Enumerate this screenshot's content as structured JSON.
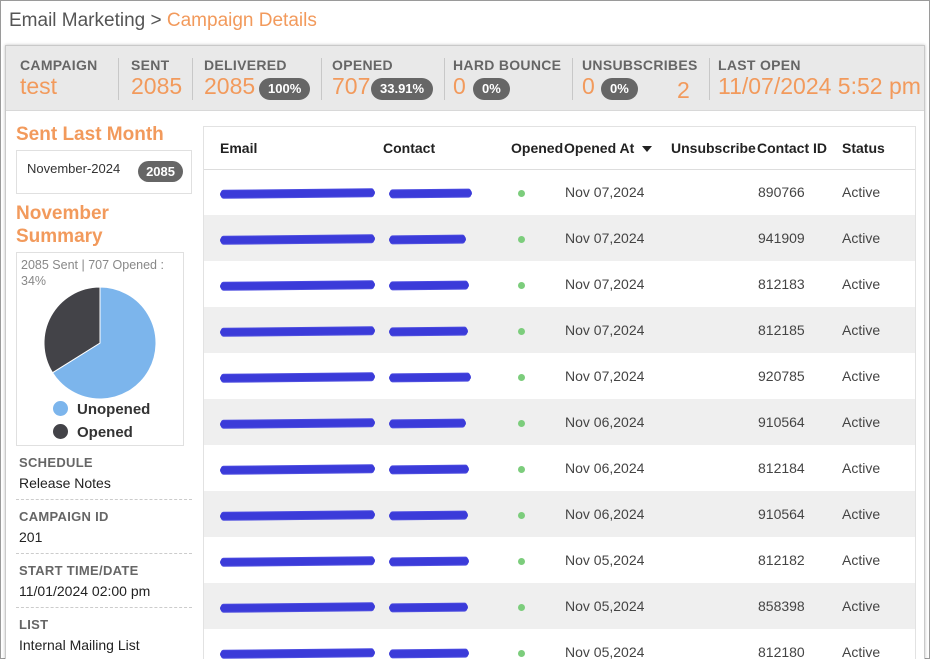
{
  "breadcrumb": {
    "parent": "Email Marketing",
    "separator": ">",
    "current": "Campaign Details"
  },
  "stats": {
    "campaign": {
      "label": "CAMPAIGN",
      "value": "test"
    },
    "sent": {
      "label": "SENT",
      "value": "2085"
    },
    "delivered": {
      "label": "DELIVERED",
      "value": "2085",
      "pct": "100%"
    },
    "opened": {
      "label": "OPENED",
      "value": "707",
      "pct": "33.91%"
    },
    "hard_bounce": {
      "label": "HARD BOUNCE",
      "value": "0",
      "pct": "0%"
    },
    "unsubscribes": {
      "label": "UNSUBSCRIBES",
      "value": "0",
      "pct": "0%",
      "extra": "2"
    },
    "last_open": {
      "label": "LAST OPEN",
      "value": "11/07/2024 5:52 pm"
    }
  },
  "sidebar": {
    "sent_last_month_title": "Sent Last Month",
    "month": "November-2024",
    "month_count": "2085",
    "summary_title": "November Summary",
    "pie_caption": "2085 Sent | 707 Opened : 34%",
    "legend": {
      "unopened": "Unopened",
      "opened": "Opened"
    },
    "meta": [
      {
        "label": "SCHEDULE",
        "value": "Release Notes"
      },
      {
        "label": "CAMPAIGN ID",
        "value": "201"
      },
      {
        "label": "START TIME/DATE",
        "value": "11/01/2024 02:00 pm"
      },
      {
        "label": "LIST",
        "value": "Internal Mailing List"
      }
    ]
  },
  "chart_data": {
    "type": "pie",
    "labels": [
      "Unopened",
      "Opened"
    ],
    "values": [
      1378,
      707
    ],
    "colors": [
      "#7cb5ec",
      "#434348"
    ]
  },
  "colors": {
    "accent": "#f29a5c",
    "pill": "#666666",
    "opened_dot": "#7ccd7c"
  },
  "table": {
    "headers": [
      "Email",
      "Contact",
      "Opened",
      "Opened At",
      "Unsubscribe",
      "Contact ID",
      "Status"
    ],
    "sort_icon": "sort-down-icon",
    "rows": [
      {
        "opened_at": "Nov 07,2024",
        "contact_id": "890766",
        "status": "Active"
      },
      {
        "opened_at": "Nov 07,2024",
        "contact_id": "941909",
        "status": "Active"
      },
      {
        "opened_at": "Nov 07,2024",
        "contact_id": "812183",
        "status": "Active"
      },
      {
        "opened_at": "Nov 07,2024",
        "contact_id": "812185",
        "status": "Active"
      },
      {
        "opened_at": "Nov 07,2024",
        "contact_id": "920785",
        "status": "Active"
      },
      {
        "opened_at": "Nov 06,2024",
        "contact_id": "910564",
        "status": "Active"
      },
      {
        "opened_at": "Nov 06,2024",
        "contact_id": "812184",
        "status": "Active"
      },
      {
        "opened_at": "Nov 06,2024",
        "contact_id": "910564",
        "status": "Active"
      },
      {
        "opened_at": "Nov 05,2024",
        "contact_id": "812182",
        "status": "Active"
      },
      {
        "opened_at": "Nov 05,2024",
        "contact_id": "858398",
        "status": "Active"
      },
      {
        "opened_at": "Nov 05,2024",
        "contact_id": "812180",
        "status": "Active"
      }
    ]
  }
}
